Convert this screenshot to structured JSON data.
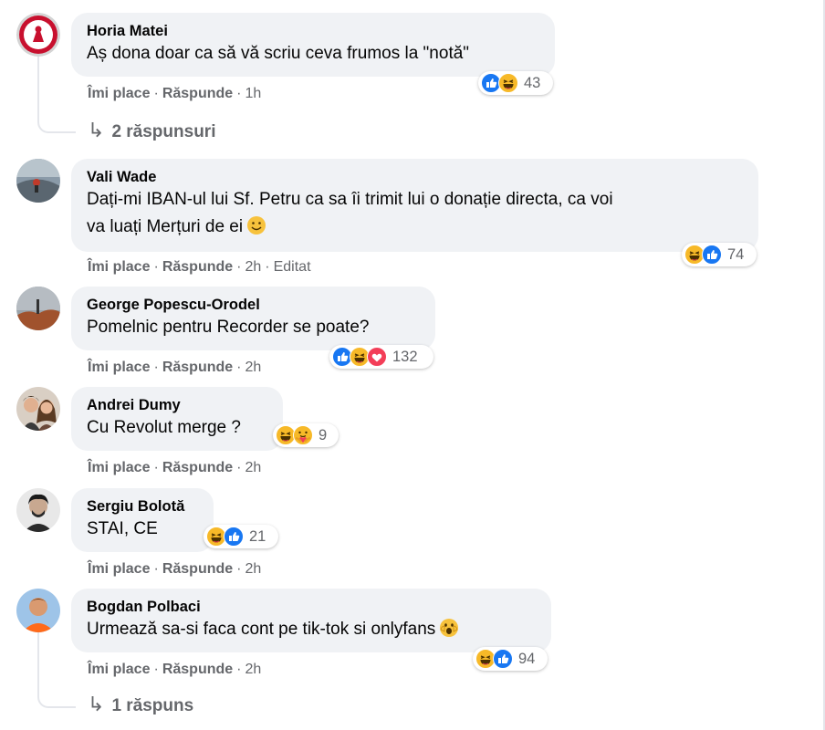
{
  "comments": [
    {
      "author": "Horia Matei",
      "text": "Aș dona doar ca să vă scriu ceva frumos la \"notă\"",
      "reactions": [
        "like",
        "haha"
      ],
      "reaction_count": "43",
      "like_label": "Îmi place",
      "reply_label": "Răspunde",
      "time": "1h",
      "replies_label": "2 răspunsuri"
    },
    {
      "author": "Vali Wade",
      "text_line1": "Dați-mi IBAN-ul lui Sf. Petru ca sa îi trimit lui o donație directa, ca voi",
      "text_line2": "va luați Merțuri de ei",
      "inline_emoji": "smile",
      "reactions": [
        "haha",
        "like"
      ],
      "reaction_count": "74",
      "like_label": "Îmi place",
      "reply_label": "Răspunde",
      "time": "2h",
      "edited_label": "Editat"
    },
    {
      "author": "George Popescu-Orodel",
      "text": "Pomelnic pentru Recorder se poate?",
      "reactions": [
        "like",
        "haha",
        "love"
      ],
      "reaction_count": "132",
      "like_label": "Îmi place",
      "reply_label": "Răspunde",
      "time": "2h"
    },
    {
      "author": "Andrei Dumy",
      "text": "Cu Revolut merge ?",
      "reactions": [
        "haha",
        "care"
      ],
      "reaction_count": "9",
      "like_label": "Îmi place",
      "reply_label": "Răspunde",
      "time": "2h"
    },
    {
      "author": "Sergiu Bolotă",
      "text": "STAI, CE",
      "reactions": [
        "haha",
        "like"
      ],
      "reaction_count": "21",
      "like_label": "Îmi place",
      "reply_label": "Răspunde",
      "time": "2h"
    },
    {
      "author": "Bogdan Polbaci",
      "text": "Urmează sa-si faca cont pe tik-tok si onlyfans",
      "inline_emoji": "wow",
      "reactions": [
        "haha",
        "like"
      ],
      "reaction_count": "94",
      "like_label": "Îmi place",
      "reply_label": "Răspunde",
      "time": "2h",
      "replies_label": "1 răspuns"
    }
  ],
  "separator": "·",
  "colors": {
    "bubble": "#f0f2f5",
    "secondary_text": "#65676b",
    "like_blue": "#1877f2",
    "haha_yellow": "#f7b928",
    "love_red": "#f33e58"
  }
}
